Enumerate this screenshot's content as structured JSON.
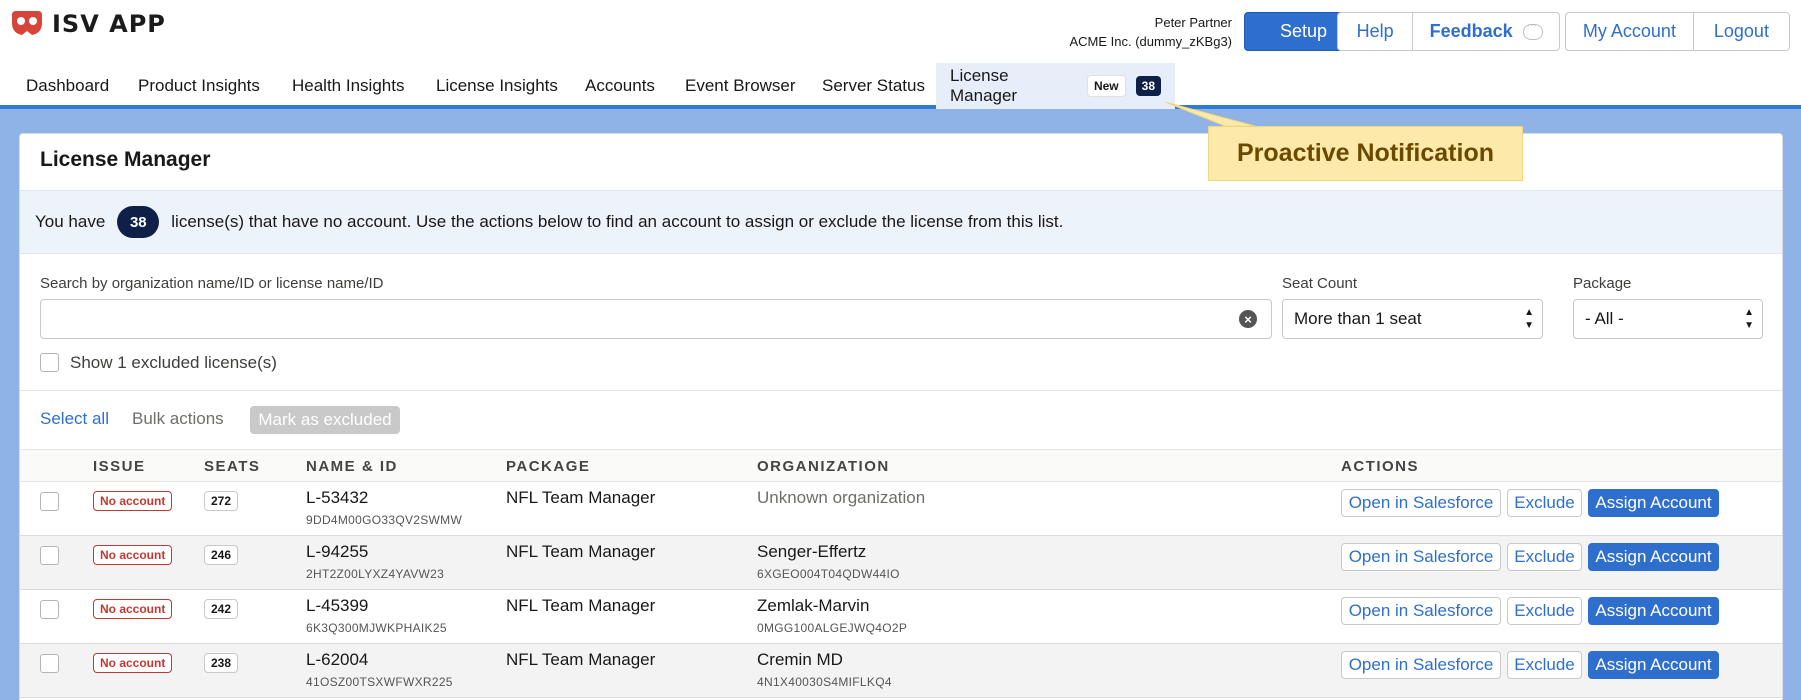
{
  "app": {
    "title": "ISV APP"
  },
  "user": {
    "name": "Peter Partner",
    "org": "ACME Inc. (dummy_zKBg3)"
  },
  "header_buttons": {
    "setup": "Setup",
    "help": "Help",
    "feedback": "Feedback",
    "my_account": "My Account",
    "logout": "Logout"
  },
  "nav": {
    "items": [
      "Dashboard",
      "Product Insights",
      "Health Insights",
      "License Insights",
      "Accounts",
      "Event Browser",
      "Server Status"
    ],
    "active": {
      "label": "License Manager",
      "new_badge": "New",
      "count": "38"
    }
  },
  "callout": {
    "text": "Proactive Notification"
  },
  "card": {
    "title": "License Manager",
    "info_prefix": "You have",
    "info_count": "38",
    "info_suffix": "license(s) that have no account. Use the actions below to find an account to assign or exclude the license from this list."
  },
  "filters": {
    "search_label": "Search by organization name/ID or license name/ID",
    "search_value": "",
    "seat_label": "Seat Count",
    "seat_value": "More than 1 seat",
    "package_label": "Package",
    "package_value": "- All -",
    "show_excluded": "Show 1 excluded license(s)"
  },
  "toolbar": {
    "select_all": "Select all",
    "bulk_actions": "Bulk actions",
    "mark_excluded": "Mark as excluded"
  },
  "table": {
    "headers": {
      "issue": "ISSUE",
      "seats": "SEATS",
      "name": "NAME & ID",
      "package": "PACKAGE",
      "organization": "ORGANIZATION",
      "actions": "ACTIONS"
    },
    "action_labels": {
      "open": "Open in Salesforce",
      "exclude": "Exclude",
      "assign": "Assign Account"
    },
    "rows": [
      {
        "issue": "No account",
        "seats": "272",
        "name": "L-53432",
        "id": "9DD4M00GO33QV2SWMW",
        "package": "NFL Team Manager",
        "org": "Unknown organization",
        "org_id": ""
      },
      {
        "issue": "No account",
        "seats": "246",
        "name": "L-94255",
        "id": "2HT2Z00LYXZ4YAVW23",
        "package": "NFL Team Manager",
        "org": "Senger-Effertz",
        "org_id": "6XGEO004T04QDW44IO"
      },
      {
        "issue": "No account",
        "seats": "242",
        "name": "L-45399",
        "id": "6K3Q300MJWKPHAIK25",
        "package": "NFL Team Manager",
        "org": "Zemlak-Marvin",
        "org_id": "0MGG100ALGEJWQ4O2P"
      },
      {
        "issue": "No account",
        "seats": "238",
        "name": "L-62004",
        "id": "41OSZ00TSXWFWXR225",
        "package": "NFL Team Manager",
        "org": "Cremin MD",
        "org_id": "4N1X40030S4MIFLKQ4"
      }
    ]
  },
  "colors": {
    "brand_blue": "#2e6fce",
    "navy": "#0e2048",
    "danger": "#c23934",
    "callout_bg": "#fde9a9"
  }
}
